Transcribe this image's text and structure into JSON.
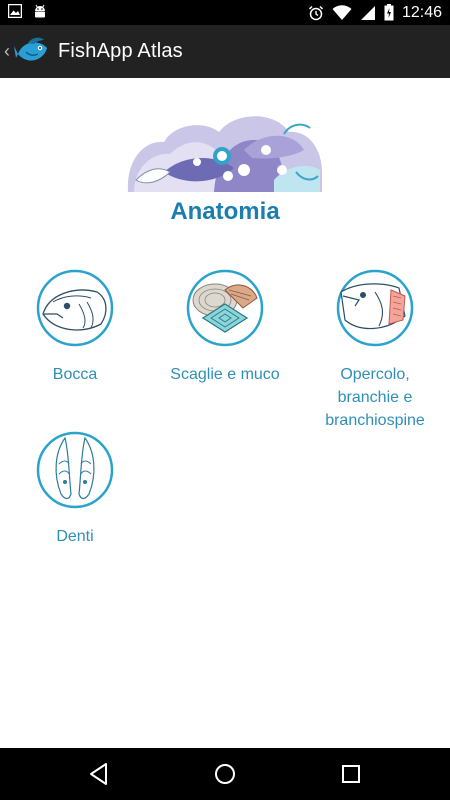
{
  "status_bar": {
    "time": "12:46",
    "icons": [
      "image-icon",
      "android-icon",
      "alarm-icon",
      "wifi-icon",
      "signal-icon",
      "battery-icon"
    ]
  },
  "action_bar": {
    "title": "FishApp Atlas"
  },
  "section": {
    "title": "Anatomia"
  },
  "tiles": [
    {
      "label": "Bocca",
      "icon": "fish-mouth-icon"
    },
    {
      "label": "Scaglie e muco",
      "icon": "fish-scales-icon"
    },
    {
      "label": "Opercolo, branchie e branchiospine",
      "label_lines": [
        "Opercolo,",
        "branchie e",
        "branchiospine"
      ],
      "icon": "fish-gill-icon"
    },
    {
      "label": "Denti",
      "icon": "fish-teeth-icon"
    }
  ],
  "nav_bar": {
    "icons": [
      "back-icon",
      "home-icon",
      "recents-icon"
    ]
  },
  "colors": {
    "accent": "#1a7fae",
    "label": "#2f8fb8",
    "action_bar": "#222222"
  }
}
